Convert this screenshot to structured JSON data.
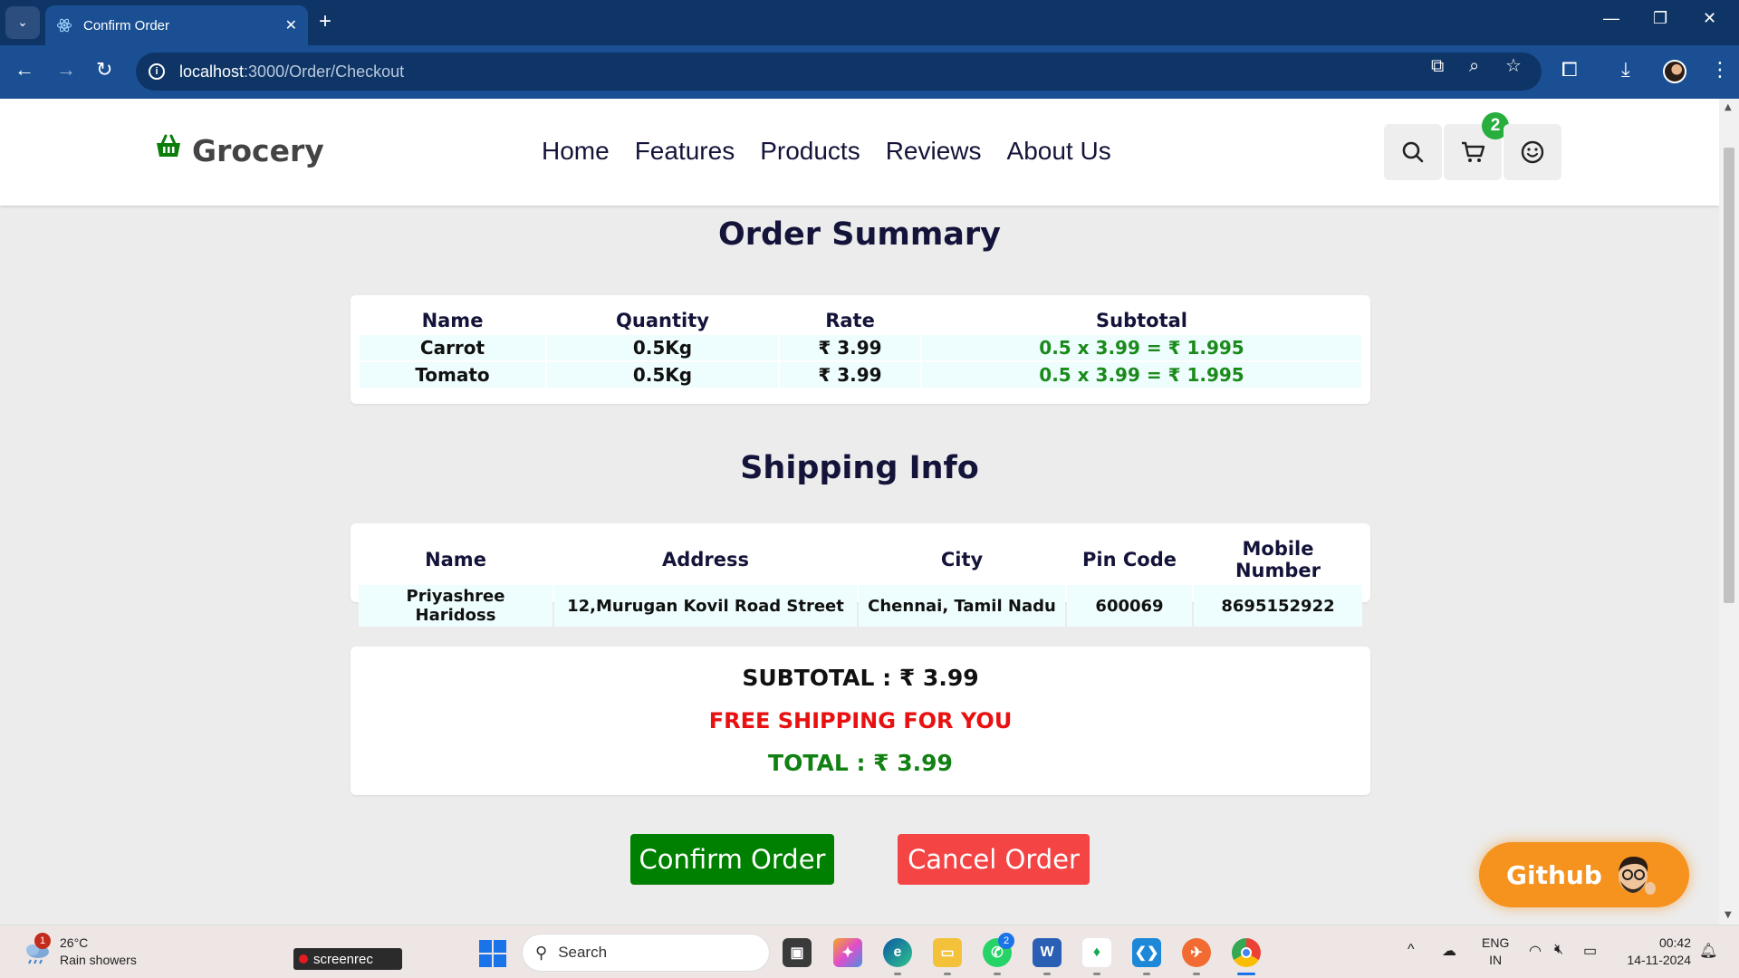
{
  "browser": {
    "tab_title": "Confirm Order",
    "url_host": "localhost",
    "url_path": ":3000/Order/Checkout"
  },
  "header": {
    "logo": "Grocery",
    "nav": [
      "Home",
      "Features",
      "Products",
      "Reviews",
      "About Us"
    ],
    "cart_count": "2"
  },
  "order_summary": {
    "title": "Order Summary",
    "columns": [
      "Name",
      "Quantity",
      "Rate",
      "Subtotal"
    ],
    "rows": [
      {
        "name": "Carrot",
        "quantity": "0.5Kg",
        "rate": "₹ 3.99",
        "subtotal": "0.5 x 3.99 = ₹ 1.995"
      },
      {
        "name": "Tomato",
        "quantity": "0.5Kg",
        "rate": "₹ 3.99",
        "subtotal": "0.5 x 3.99 = ₹ 1.995"
      }
    ]
  },
  "shipping": {
    "title": "Shipping Info",
    "columns": [
      "Name",
      "Address",
      "City",
      "Pin Code",
      "Mobile Number"
    ],
    "row": {
      "name": "Priyashree Haridoss",
      "address": "12,Murugan Kovil Road Street",
      "city": "Chennai, Tamil Nadu",
      "pin": "600069",
      "mobile": "8695152922"
    }
  },
  "totals": {
    "subtotal": "SUBTOTAL :  ₹ 3.99",
    "shipping": "FREE SHIPPING FOR YOU",
    "total": "TOTAL :  ₹ 3.99"
  },
  "actions": {
    "confirm": "Confirm Order",
    "cancel": "Cancel Order"
  },
  "github_label": "Github",
  "taskbar": {
    "weather_badge": "1",
    "temperature": "26°C",
    "weather": "Rain showers",
    "screenrec": "screenrec",
    "search_placeholder": "Search",
    "whatsapp_badge": "2",
    "lang_1": "ENG",
    "lang_2": "IN",
    "time": "00:42",
    "date": "14-11-2024"
  },
  "colors": {
    "brand_green": "#008000",
    "cancel_red": "#f44444",
    "free_shipping_red": "#e81010",
    "github_orange": "#f6921e",
    "chrome_blue": "#1a4f93"
  }
}
